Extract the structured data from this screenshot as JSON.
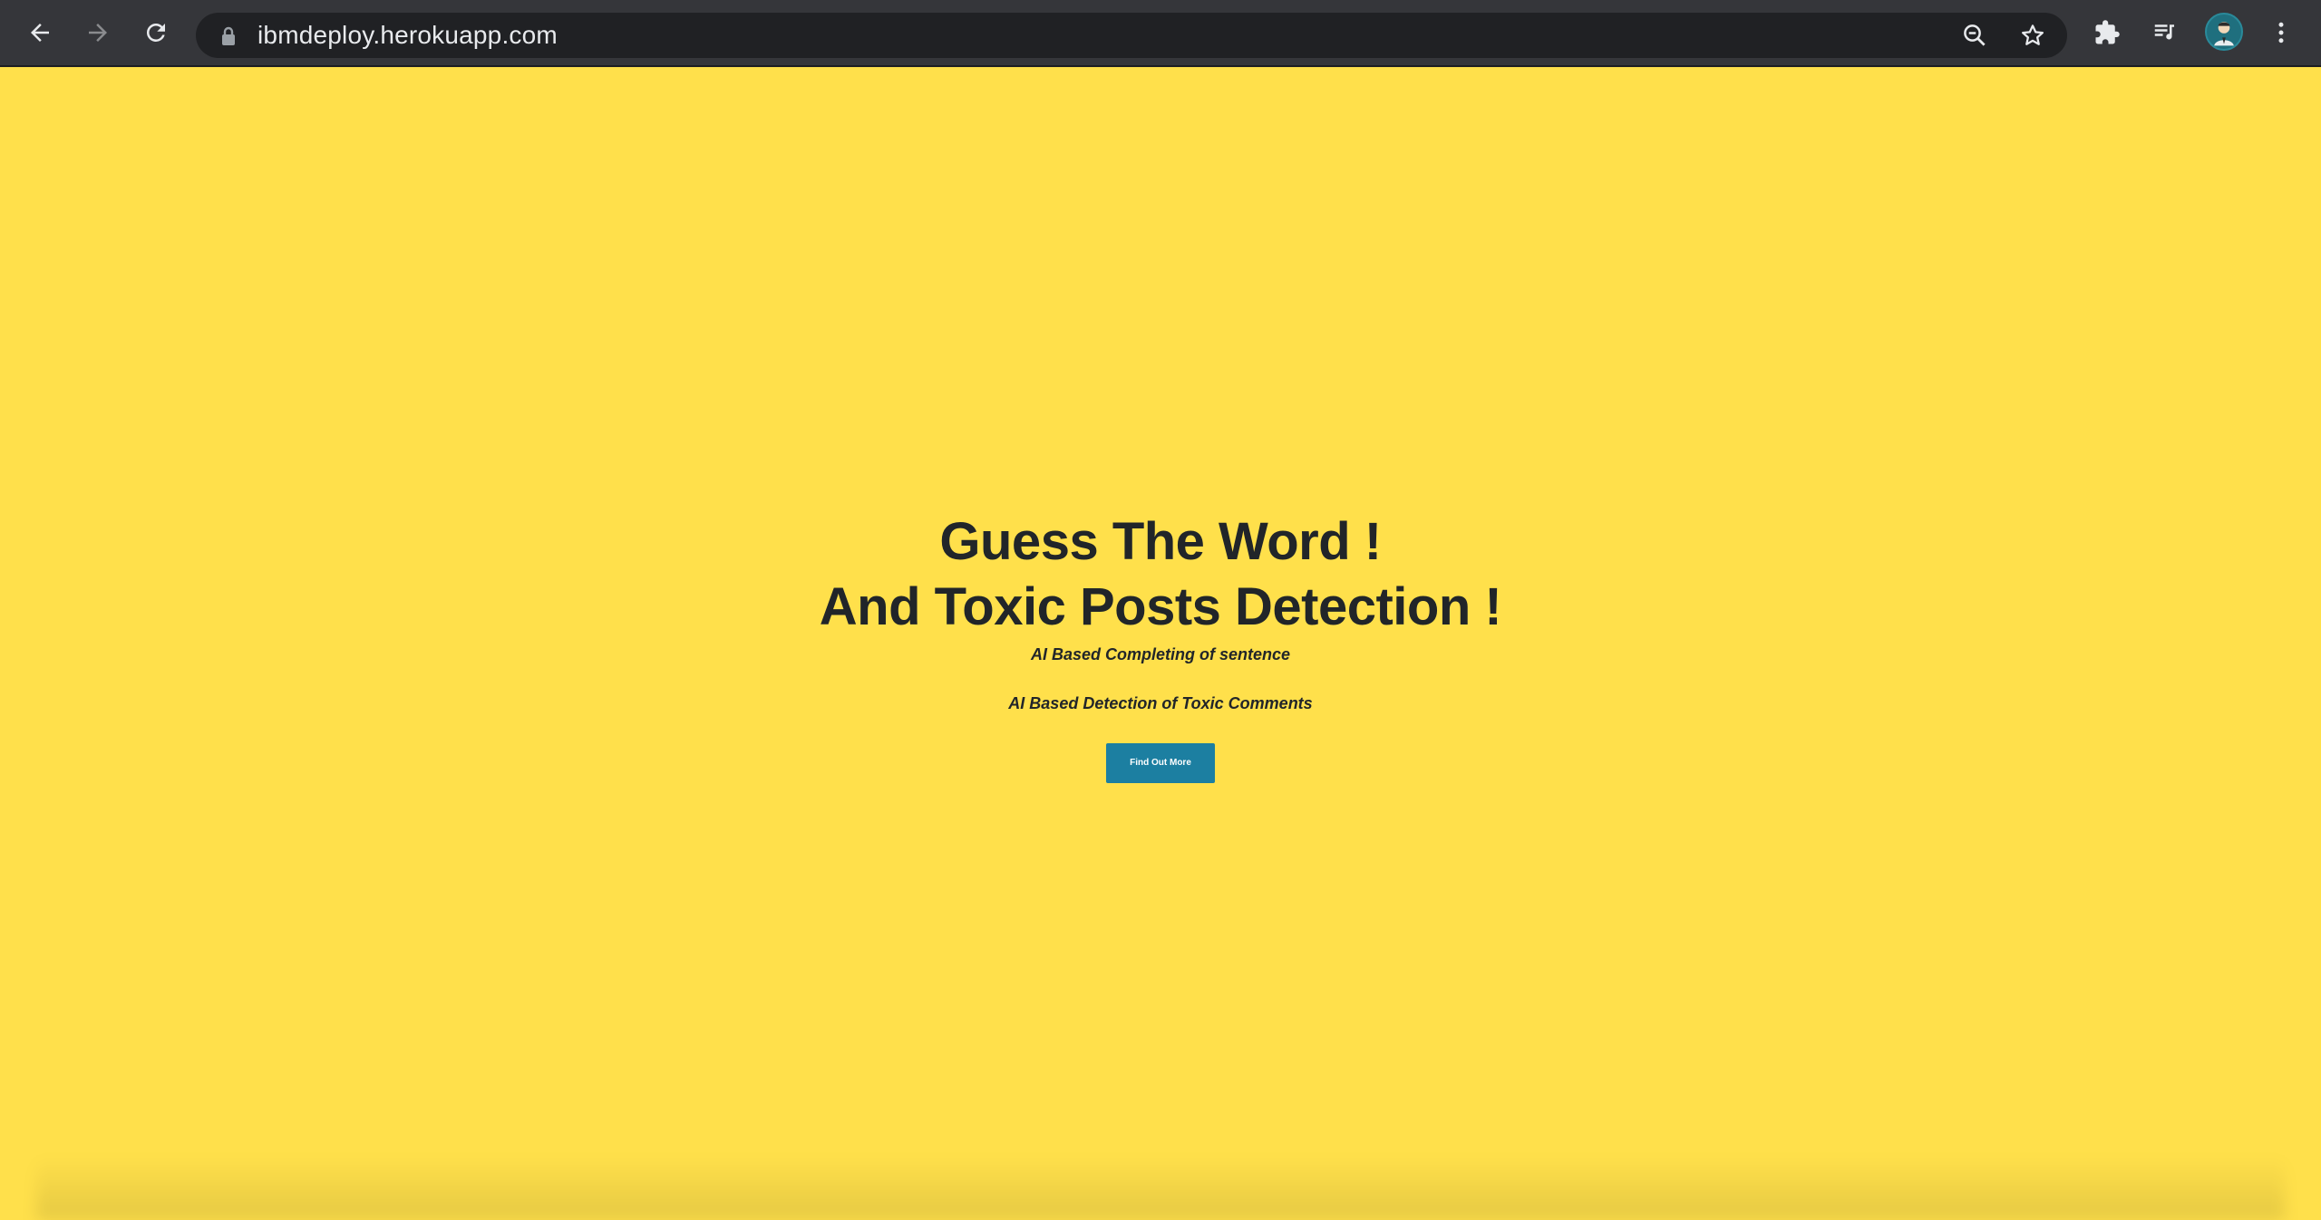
{
  "browser": {
    "url": "ibmdeploy.herokuapp.com",
    "icons": [
      "back-arrow-icon",
      "forward-arrow-icon",
      "reload-icon",
      "lock-icon",
      "zoom-icon",
      "star-icon",
      "extensions-icon",
      "media-queue-icon",
      "avatar",
      "more-vertical-icon"
    ]
  },
  "hero": {
    "title_line1": "Guess The Word !",
    "title_line2": "And Toxic Posts Detection !",
    "subtitle1": "AI Based Completing of sentence",
    "subtitle2": "AI Based Detection of Toxic Comments",
    "button_label": "Find Out More"
  },
  "colors": {
    "background": "#ffe04b",
    "button": "#1c7fa1",
    "text": "#212529",
    "toolbar": "#35363a"
  }
}
